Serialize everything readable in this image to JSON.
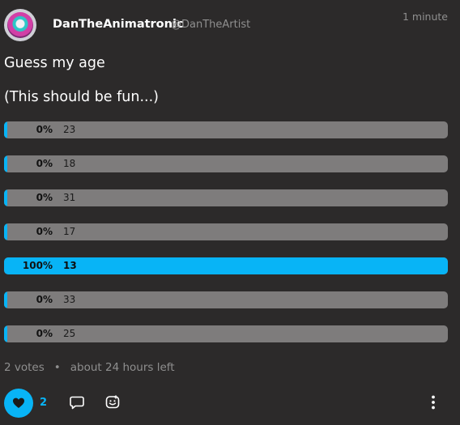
{
  "post": {
    "display_name": "DanTheAnimatronic",
    "handle": "@DanTheArtist",
    "timestamp": "1 minute",
    "text_line1": "Guess my age",
    "text_line2": "(This should be fun...)"
  },
  "poll": {
    "options": [
      {
        "percent": "0%",
        "label": "23",
        "value": 0
      },
      {
        "percent": "0%",
        "label": "18",
        "value": 0
      },
      {
        "percent": "0%",
        "label": "31",
        "value": 0
      },
      {
        "percent": "0%",
        "label": "17",
        "value": 0
      },
      {
        "percent": "100%",
        "label": "13",
        "value": 100
      },
      {
        "percent": "0%",
        "label": "33",
        "value": 0
      },
      {
        "percent": "0%",
        "label": "25",
        "value": 0
      }
    ],
    "votes": "2 votes",
    "separator": "•",
    "time_left": "about 24 hours left"
  },
  "actions": {
    "like_count": "2"
  },
  "colors": {
    "accent": "#08b4f6",
    "background": "#2c2a2a",
    "poll_track": "#7e7c7c",
    "muted_text": "#8f8f8f"
  },
  "icons": {
    "avatar": "avatar",
    "like": "heart-icon",
    "reply": "reply-icon",
    "react": "emoji-react-icon",
    "more": "more-vertical-icon"
  }
}
